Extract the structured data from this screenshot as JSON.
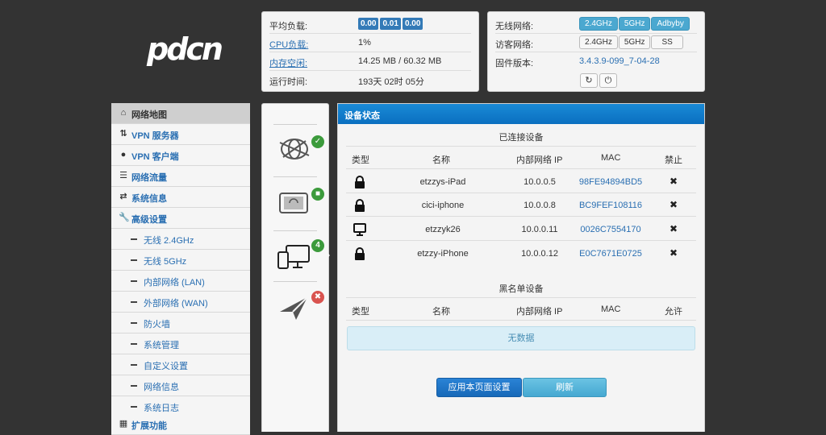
{
  "logo": {
    "text": "pdcn"
  },
  "system": {
    "load_label": "平均负载:",
    "load_values": [
      "0.00",
      "0.01",
      "0.00"
    ],
    "cpu_label": "CPU负载:",
    "cpu_value": "1%",
    "mem_label": "内存空闲:",
    "mem_value": "14.25 MB / 60.32 MB",
    "uptime_label": "运行时间:",
    "uptime_value": "193天 02时 05分"
  },
  "network": {
    "wifi_label": "无线网络:",
    "wifi_options": [
      "2.4GHz",
      "5GHz",
      "Adbyby"
    ],
    "guest_label": "访客网络:",
    "guest_options": [
      "2.4GHz",
      "5GHz",
      "SS"
    ],
    "firmware_label": "固件版本:",
    "firmware_value": "3.4.3.9-099_7-04-28"
  },
  "sidebar": {
    "items": [
      {
        "label": "网络地图",
        "icon": "home-icon"
      },
      {
        "label": "VPN 服务器",
        "icon": "exchange-icon"
      },
      {
        "label": "VPN 客户端",
        "icon": "globe-icon"
      },
      {
        "label": "网络流量",
        "icon": "list-icon"
      },
      {
        "label": "系统信息",
        "icon": "random-icon"
      },
      {
        "label": "高级设置",
        "icon": "wrench-icon"
      }
    ],
    "subitems": [
      "无线 2.4GHz",
      "无线 5GHz",
      "内部网络 (LAN)",
      "外部网络 (WAN)",
      "防火墙",
      "系统管理",
      "自定义设置",
      "网络信息",
      "系统日志"
    ],
    "extra": {
      "label": "扩展功能",
      "icon": "grid-icon"
    }
  },
  "iconcol": {
    "clients_count": "4"
  },
  "main": {
    "header": "设备状态",
    "connected_title": "已连接设备",
    "columns": [
      "类型",
      "名称",
      "内部网络 IP",
      "MAC",
      "禁止"
    ],
    "devices": [
      {
        "name": "etzzys-iPad",
        "ip": "10.0.0.5",
        "mac": "98FE94894BD5",
        "type": "lock"
      },
      {
        "name": "cici-iphone",
        "ip": "10.0.0.8",
        "mac": "BC9FEF108116",
        "type": "lock"
      },
      {
        "name": "etzzyk26",
        "ip": "10.0.0.11",
        "mac": "0026C7554170",
        "type": "desktop"
      },
      {
        "name": "etzzy-iPhone",
        "ip": "10.0.0.12",
        "mac": "E0C7671E0725",
        "type": "lock"
      }
    ],
    "blacklist_title": "黑名单设备",
    "blacklist_columns": [
      "类型",
      "名称",
      "内部网络 IP",
      "MAC",
      "允许"
    ],
    "empty_text": "无数据",
    "apply_button": "应用本页面设置",
    "refresh_button": "刷新"
  }
}
